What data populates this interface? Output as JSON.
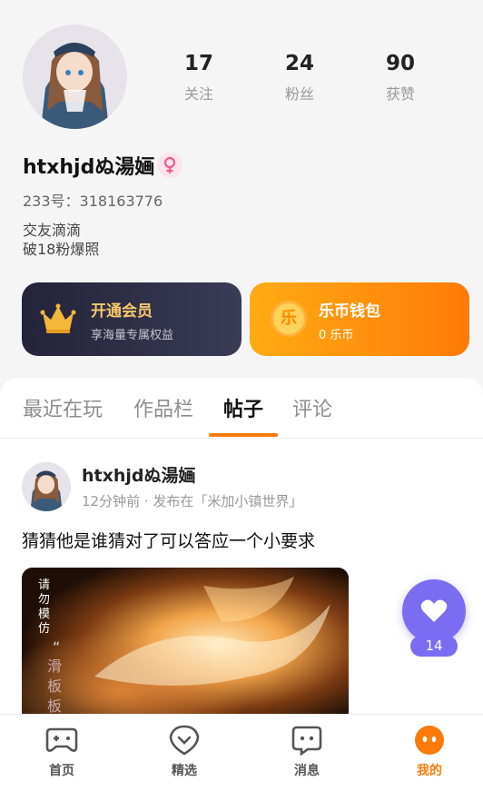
{
  "profile": {
    "username": "htxhjdぬ湯婳",
    "uid_line": "233号：318163776",
    "bio_lines": [
      "交友滴滴",
      "破18粉爆照"
    ],
    "gender_icon": "female-icon"
  },
  "stats": [
    {
      "value": "17",
      "label": "关注"
    },
    {
      "value": "24",
      "label": "粉丝"
    },
    {
      "value": "90",
      "label": "获赞"
    }
  ],
  "cards": {
    "vip": {
      "title": "开通会员",
      "subtitle": "享海量专属权益",
      "icon": "crown-icon"
    },
    "wallet": {
      "title": "乐币钱包",
      "subtitle": "0 乐币",
      "icon_char": "乐"
    }
  },
  "tabs": [
    {
      "label": "最近在玩",
      "active": false
    },
    {
      "label": "作品栏",
      "active": false
    },
    {
      "label": "帖子",
      "active": true
    },
    {
      "label": "评论",
      "active": false
    }
  ],
  "post": {
    "author": "htxhjdぬ湯婳",
    "meta": "12分钟前 · 发布在「米加小镇世界」",
    "text": "猜猜他是谁猜对了可以答应一个小要求",
    "image_text_top": "请勿模仿",
    "image_quote": "“",
    "image_text_side": "滑板板",
    "like_count": "14"
  },
  "bottom_nav": [
    {
      "label": "首页",
      "icon": "gamepad-icon",
      "active": false
    },
    {
      "label": "精选",
      "icon": "heart-badge-icon",
      "active": false
    },
    {
      "label": "消息",
      "icon": "message-icon",
      "active": false
    },
    {
      "label": "我的",
      "icon": "profile-face-icon",
      "active": true
    }
  ],
  "colors": {
    "accent": "#ff7a08",
    "like_button": "#7b6cf2",
    "vip_title": "#f7c96b"
  }
}
